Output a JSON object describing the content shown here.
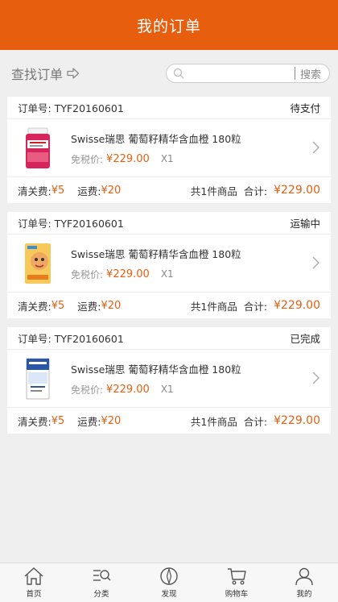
{
  "header": {
    "title": "我的订单"
  },
  "toolbar": {
    "find_label": "查找订单",
    "search_placeholder": "",
    "search_button": "搜索"
  },
  "orders": [
    {
      "order_no": "订单号: TYF20160601",
      "status": "待支付",
      "product_name": "Swisse瑞思 葡萄籽精华含血橙 180粒",
      "price_label": "免税价:",
      "price": "¥229.00",
      "qty": "X1",
      "customs_label": "清关费:",
      "customs_value": "¥5",
      "shipping_label": "运费:",
      "shipping_value": "¥20",
      "count_label": "共1件商品",
      "total_label": "合计:",
      "total_value": "¥229.00"
    },
    {
      "order_no": "订单号: TYF20160601",
      "status": "运输中",
      "product_name": "Swisse瑞思 葡萄籽精华含血橙 180粒",
      "price_label": "免税价:",
      "price": "¥229.00",
      "qty": "X1",
      "customs_label": "清关费:",
      "customs_value": "¥5",
      "shipping_label": "运费:",
      "shipping_value": "¥20",
      "count_label": "共1件商品",
      "total_label": "合计:",
      "total_value": "¥229.00"
    },
    {
      "order_no": "订单号: TYF20160601",
      "status": "已完成",
      "product_name": "Swisse瑞思 葡萄籽精华含血橙 180粒",
      "price_label": "免税价:",
      "price": "¥229.00",
      "qty": "X1",
      "customs_label": "清关费:",
      "customs_value": "¥5",
      "shipping_label": "运费:",
      "shipping_value": "¥20",
      "count_label": "共1件商品",
      "total_label": "合计:",
      "total_value": "¥229.00"
    }
  ],
  "tabs": [
    {
      "label": "首页",
      "icon": "home-icon"
    },
    {
      "label": "分类",
      "icon": "category-search-icon"
    },
    {
      "label": "发现",
      "icon": "compass-icon"
    },
    {
      "label": "购物车",
      "icon": "cart-icon"
    },
    {
      "label": "我的",
      "icon": "user-icon"
    }
  ],
  "colors": {
    "accent": "#e75e0e",
    "background": "#efefef"
  }
}
